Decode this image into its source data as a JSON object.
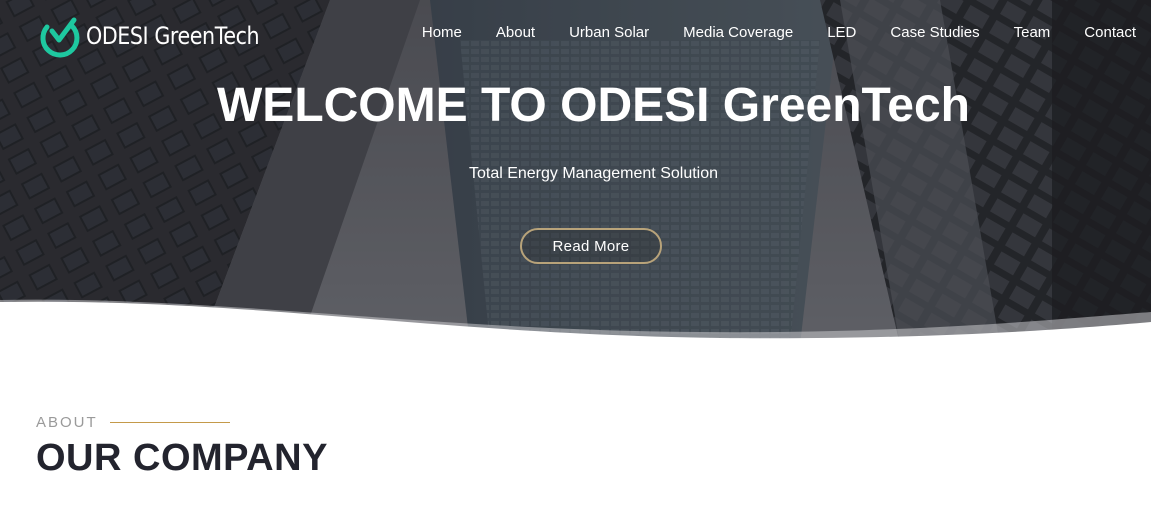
{
  "brand": {
    "name": "ODESI GreenTech",
    "logo_icon": "check-circle-logo-icon",
    "colors": {
      "logo_teal": "#1ec8a0",
      "accent_gold": "#c49a4a",
      "heading_dark": "#23242e"
    }
  },
  "nav": {
    "items": [
      {
        "label": "Home"
      },
      {
        "label": "About"
      },
      {
        "label": "Urban Solar"
      },
      {
        "label": "Media Coverage"
      },
      {
        "label": "LED"
      },
      {
        "label": "Case Studies"
      },
      {
        "label": "Team"
      },
      {
        "label": "Contact"
      }
    ]
  },
  "hero": {
    "title": "WELCOME TO ODESI GreenTech",
    "subtitle": "Total Energy Management Solution",
    "cta_label": "Read More"
  },
  "about": {
    "kicker": "ABOUT",
    "title": "OUR COMPANY"
  }
}
